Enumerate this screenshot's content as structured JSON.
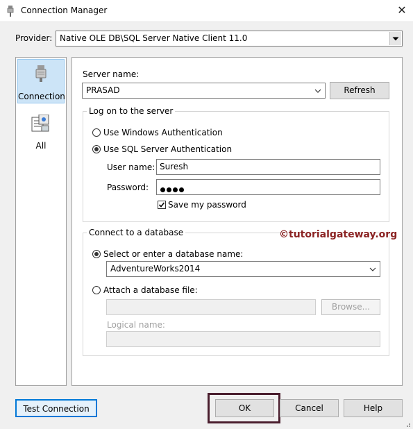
{
  "window": {
    "title": "Connection Manager",
    "close_label": "✕"
  },
  "provider": {
    "label": "Provider:",
    "value": "Native OLE DB\\SQL Server Native Client 11.0"
  },
  "nav": {
    "items": [
      {
        "label": "Connection",
        "selected": true,
        "icon": "database-icon"
      },
      {
        "label": "All",
        "selected": false,
        "icon": "all-properties-icon"
      }
    ]
  },
  "server": {
    "label": "Server name:",
    "value": "PRASAD",
    "refresh_label": "Refresh"
  },
  "logon": {
    "group_title": "Log on to the server",
    "windows_auth_label": "Use Windows Authentication",
    "sql_auth_label": "Use SQL Server Authentication",
    "selected": "sql",
    "username_label": "User name:",
    "username_value": "Suresh",
    "password_label": "Password:",
    "password_mask_length": 4,
    "save_password_label": "Save my password",
    "save_password_checked": true
  },
  "database": {
    "group_title": "Connect to a database",
    "select_label": "Select or enter a database name:",
    "db_value": "AdventureWorks2014",
    "attach_label": "Attach a database file:",
    "browse_label": "Browse...",
    "logical_name_label": "Logical name:",
    "selected": "select"
  },
  "watermark": "©tutorialgateway.org",
  "footer": {
    "test_connection_label": "Test Connection",
    "ok_label": "OK",
    "cancel_label": "Cancel",
    "help_label": "Help"
  },
  "colors": {
    "highlight_border": "#4a1e2e",
    "watermark": "#8b2323",
    "nav_selected": "#cce4f7"
  }
}
